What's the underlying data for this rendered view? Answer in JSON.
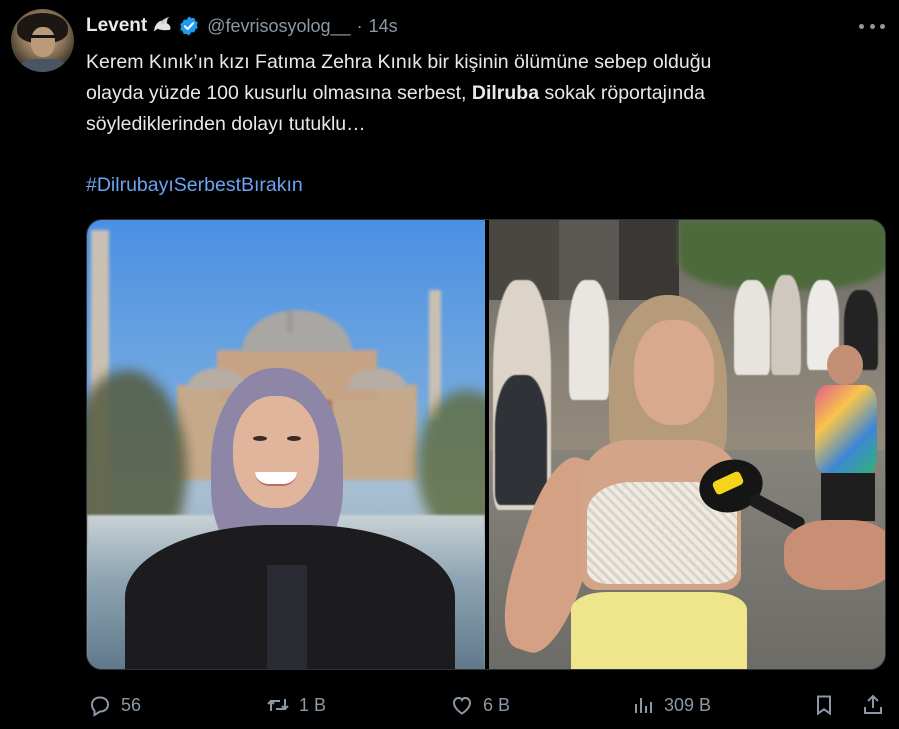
{
  "tweet": {
    "display_name": "Levent",
    "handle": "@fevrisosyolog__",
    "separator": "·",
    "time": "14s",
    "text_lines": [
      "Kerem Kınık’ın kızı Fatıma Zehra Kınık bir kişinin ölümüne sebep olduğu",
      "olayda yüzde 100 kusurlu olmasına serbest, ",
      "söylediklerinden dolayı tutuklu…"
    ],
    "bold_word": "Dilruba",
    "line2_tail": " sokak röportajında",
    "hashtag": "#DilrubayıSerbestBırakın"
  },
  "mic_label": "",
  "actions": {
    "replies": "56",
    "retweets": "1 B",
    "likes": "6 B",
    "views": "309 B"
  },
  "icons": {
    "verified": "verified-badge-icon",
    "dove": "dove-icon",
    "more": "more-icon",
    "reply": "reply-icon",
    "retweet": "retweet-icon",
    "like": "heart-icon",
    "views": "views-icon",
    "bookmark": "bookmark-icon",
    "share": "share-icon"
  },
  "colors": {
    "background": "#000000",
    "text": "#e7e9ea",
    "secondary": "#8b98a5",
    "link": "#6ba4f0",
    "verified": "#1d9bf0"
  }
}
